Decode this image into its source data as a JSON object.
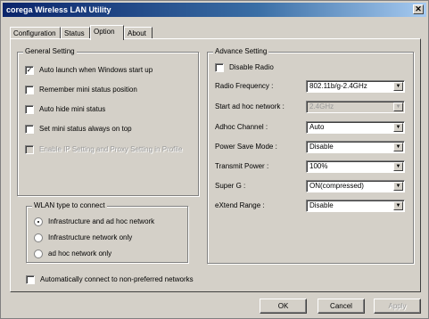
{
  "window": {
    "title": "corega Wireless LAN Utility",
    "close_symbol": "✕"
  },
  "tabs": [
    {
      "label": "Configuration"
    },
    {
      "label": "Status"
    },
    {
      "label": "Option"
    },
    {
      "label": "About"
    }
  ],
  "active_tab": "Option",
  "general": {
    "title": "General Setting",
    "items": [
      {
        "label": "Auto launch when Windows start up",
        "checked": true
      },
      {
        "label": "Remember mini status position",
        "checked": false
      },
      {
        "label": "Auto hide mini status",
        "checked": false
      },
      {
        "label": "Set mini status always on top",
        "checked": false
      },
      {
        "label": "Enable IP Setting and Proxy Setting in Profile",
        "checked": false,
        "disabled": true
      }
    ]
  },
  "wlan": {
    "title": "WLAN type to connect",
    "options": [
      {
        "label": "Infrastructure and ad hoc network",
        "selected": true
      },
      {
        "label": "Infrastructure network only",
        "selected": false
      },
      {
        "label": "ad hoc network only",
        "selected": false
      }
    ]
  },
  "auto_connect": {
    "label": "Automatically connect to non-preferred networks",
    "checked": false
  },
  "advance": {
    "title": "Advance Setting",
    "disable_radio": {
      "label": "Disable Radio",
      "checked": false
    },
    "fields": [
      {
        "label": "Radio Frequency :",
        "value": "802.11b/g-2.4GHz",
        "disabled": false
      },
      {
        "label": "Start ad hoc network :",
        "value": "2.4GHz",
        "disabled": true
      },
      {
        "label": "Adhoc Channel :",
        "value": "Auto",
        "disabled": false
      },
      {
        "label": "Power Save Mode :",
        "value": "Disable",
        "disabled": false
      },
      {
        "label": "Transmit Power :",
        "value": "100%",
        "disabled": false
      },
      {
        "label": "Super G :",
        "value": "ON(compressed)",
        "disabled": false
      },
      {
        "label": "eXtend Range :",
        "value": "Disable",
        "disabled": false
      }
    ]
  },
  "buttons": {
    "ok": "OK",
    "cancel": "Cancel",
    "apply": "Apply"
  },
  "icons": {
    "checkmark": "✓",
    "dropdown": "▼"
  }
}
